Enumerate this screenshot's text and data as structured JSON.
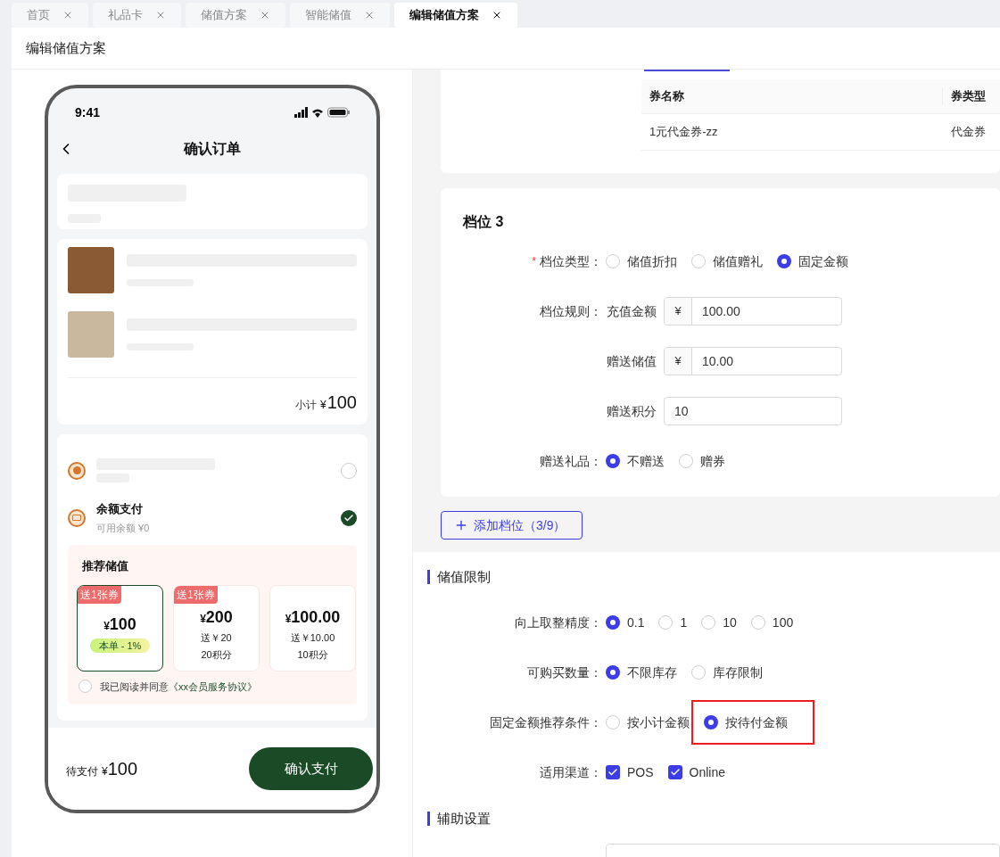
{
  "tabs": [
    {
      "label": "首页",
      "selected": false
    },
    {
      "label": "礼品卡",
      "selected": false
    },
    {
      "label": "储值方案",
      "selected": false
    },
    {
      "label": "智能储值",
      "selected": false
    },
    {
      "label": "编辑储值方案",
      "selected": true
    }
  ],
  "page_title": "编辑储值方案",
  "phone": {
    "time": "9:41",
    "title": "确认订单",
    "subtotal_label": "小计",
    "subtotal_currency": "¥",
    "subtotal": "100",
    "payment_methods": [
      {
        "kind": "placeholder",
        "selected": false
      },
      {
        "kind": "balance",
        "title": "余额支付",
        "subtitle": "可用余额 ¥0",
        "selected": true
      }
    ],
    "recommend": {
      "title": "推荐储值",
      "options": [
        {
          "badge": "送1张券",
          "currency": "¥",
          "amount": "100",
          "discount": "本单 - 1%",
          "selected": true
        },
        {
          "badge": "送1张券",
          "currency": "¥",
          "amount": "200",
          "lines": [
            "送￥20",
            "20积分"
          ],
          "selected": false
        },
        {
          "currency": "¥",
          "amount": "100.00",
          "lines": [
            "送￥10.00",
            "10积分"
          ],
          "selected": false
        }
      ],
      "agreement": {
        "text": "我已阅读并同意",
        "link": "《xx会员服务协议》",
        "checked": false
      }
    },
    "footer": {
      "label": "待支付",
      "currency": "¥",
      "amount": "100",
      "button": "确认支付"
    }
  },
  "coupon_table": {
    "columns": [
      "券名称",
      "券类型"
    ],
    "rows": [
      [
        "1元代金券-zz",
        "代金券"
      ]
    ]
  },
  "tier": {
    "title": "档位 3",
    "type": {
      "label": "档位类型：",
      "required_mark": "*",
      "options": [
        {
          "label": "储值折扣",
          "selected": false
        },
        {
          "label": "储值赠礼",
          "selected": false
        },
        {
          "label": "固定金额",
          "selected": true
        }
      ]
    },
    "rule_label": "档位规则：",
    "amounts": [
      {
        "label": "充值金额",
        "prefix": "¥",
        "value": "100.00"
      },
      {
        "label": "赠送储值",
        "prefix": "¥",
        "value": "10.00"
      },
      {
        "label": "赠送积分",
        "value": "10"
      }
    ],
    "gift": {
      "label": "赠送礼品：",
      "options": [
        {
          "label": "不赠送",
          "selected": true
        },
        {
          "label": "赠券",
          "selected": false
        }
      ]
    }
  },
  "add_button": "添加档位（3/9）",
  "limits": {
    "title": "储值限制",
    "rows": [
      {
        "kind": "radio",
        "label": "向上取整精度：",
        "options": [
          {
            "label": "0.1",
            "selected": true,
            "highlighted": false
          },
          {
            "label": "1",
            "selected": false,
            "highlighted": false
          },
          {
            "label": "10",
            "selected": false,
            "highlighted": false
          },
          {
            "label": "100",
            "selected": false,
            "highlighted": false
          }
        ]
      },
      {
        "kind": "radio",
        "label": "可购买数量：",
        "options": [
          {
            "label": "不限库存",
            "selected": true,
            "highlighted": false
          },
          {
            "label": "库存限制",
            "selected": false,
            "highlighted": false
          }
        ]
      },
      {
        "kind": "radio",
        "label": "固定金额推荐条件：",
        "options": [
          {
            "label": "按小计金额",
            "selected": false,
            "highlighted": false
          },
          {
            "label": "按待付金额",
            "selected": true,
            "highlighted": true
          }
        ]
      },
      {
        "kind": "checkbox",
        "label": "适用渠道：",
        "options": [
          {
            "label": "POS",
            "checked": true
          },
          {
            "label": "Online",
            "checked": true
          }
        ]
      }
    ]
  },
  "aux": {
    "title": "辅助设置"
  }
}
